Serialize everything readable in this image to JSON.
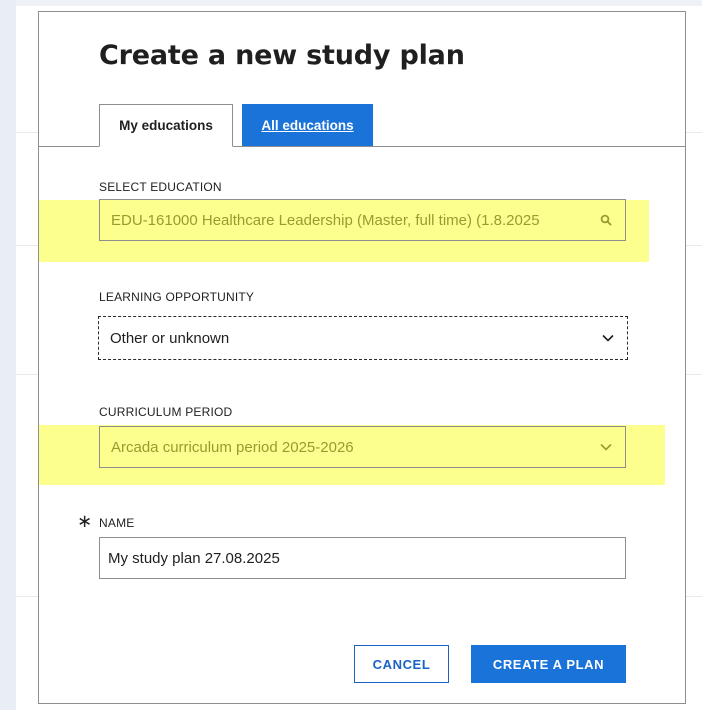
{
  "modal": {
    "title": "Create a new study plan",
    "tabs": [
      {
        "label": "My educations",
        "active": true
      },
      {
        "label": "All educations",
        "active": false
      }
    ],
    "select_education": {
      "label": "SELECT EDUCATION",
      "value": "EDU-161000 Healthcare Leadership (Master, full time) (1.8.2025",
      "icon": "search-icon"
    },
    "learning_opportunity": {
      "label": "LEARNING OPPORTUNITY",
      "value": "Other or unknown",
      "icon": "chevron-down-icon"
    },
    "curriculum_period": {
      "label": "CURRICULUM PERIOD",
      "value": "Arcada curriculum period 2025-2026",
      "icon": "chevron-down-icon"
    },
    "name": {
      "required_mark": "∗",
      "label": "NAME",
      "value": "My study plan 27.08.2025"
    },
    "buttons": {
      "cancel": "CANCEL",
      "create": "CREATE A PLAN"
    }
  },
  "colors": {
    "primary": "#1a73d9",
    "highlight": "#fbff7a",
    "border": "#8e8e8e",
    "text": "#1f1f1f"
  }
}
